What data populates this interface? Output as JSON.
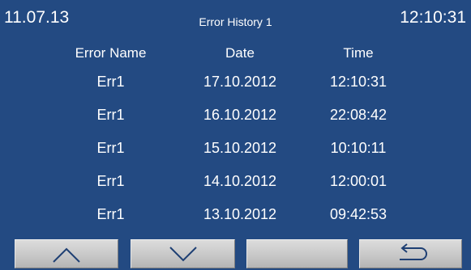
{
  "status": {
    "date": "11.07.13",
    "time": "12:10:31"
  },
  "title": "Error History 1",
  "table": {
    "headers": [
      "Error Name",
      "Date",
      "Time"
    ],
    "rows": [
      {
        "name": "Err1",
        "date": "17.10.2012",
        "time": "12:10:31"
      },
      {
        "name": "Err1",
        "date": "16.10.2012",
        "time": "22:08:42"
      },
      {
        "name": "Err1",
        "date": "15.10.2012",
        "time": "10:10:11"
      },
      {
        "name": "Err1",
        "date": "14.10.2012",
        "time": "12:00:01"
      },
      {
        "name": "Err1",
        "date": "13.10.2012",
        "time": "09:42:53"
      }
    ]
  },
  "toolbar": {
    "buttons": [
      {
        "icon": "chevron-up-icon"
      },
      {
        "icon": "chevron-down-icon"
      },
      {
        "icon": ""
      },
      {
        "icon": "return-arrow-icon"
      }
    ]
  },
  "colors": {
    "background": "#234a82",
    "text": "#ffffff",
    "button": "#c8c8c8",
    "icon_stroke": "#1e3f73"
  }
}
